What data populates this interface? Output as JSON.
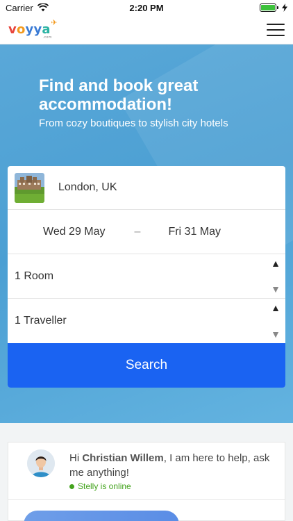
{
  "status_bar": {
    "carrier": "Carrier",
    "time": "2:20 PM",
    "battery_level": 1.0
  },
  "nav": {
    "logo_letters": [
      "v",
      "o",
      "y",
      "y",
      "a"
    ],
    "logo_sub": ".com",
    "menu_icon": "hamburger-menu-icon"
  },
  "hero": {
    "title": "Find and book great accommodation!",
    "subtitle": "From cozy boutiques to stylish city hotels"
  },
  "search": {
    "destination": "London, UK",
    "check_in": "Wed 29 May",
    "date_separator": "–",
    "check_out": "Fri 31 May",
    "rooms": "1 Room",
    "travellers": "1 Traveller",
    "search_label": "Search"
  },
  "chat": {
    "greeting_prefix": "Hi ",
    "user_name": "Christian Willem",
    "greeting_suffix": ", I am here to help, ask me anything!",
    "online_status": "Stelly is online"
  },
  "colors": {
    "accent": "#1a63f2",
    "hero": "#4b9fd3",
    "online": "#43a31d"
  }
}
